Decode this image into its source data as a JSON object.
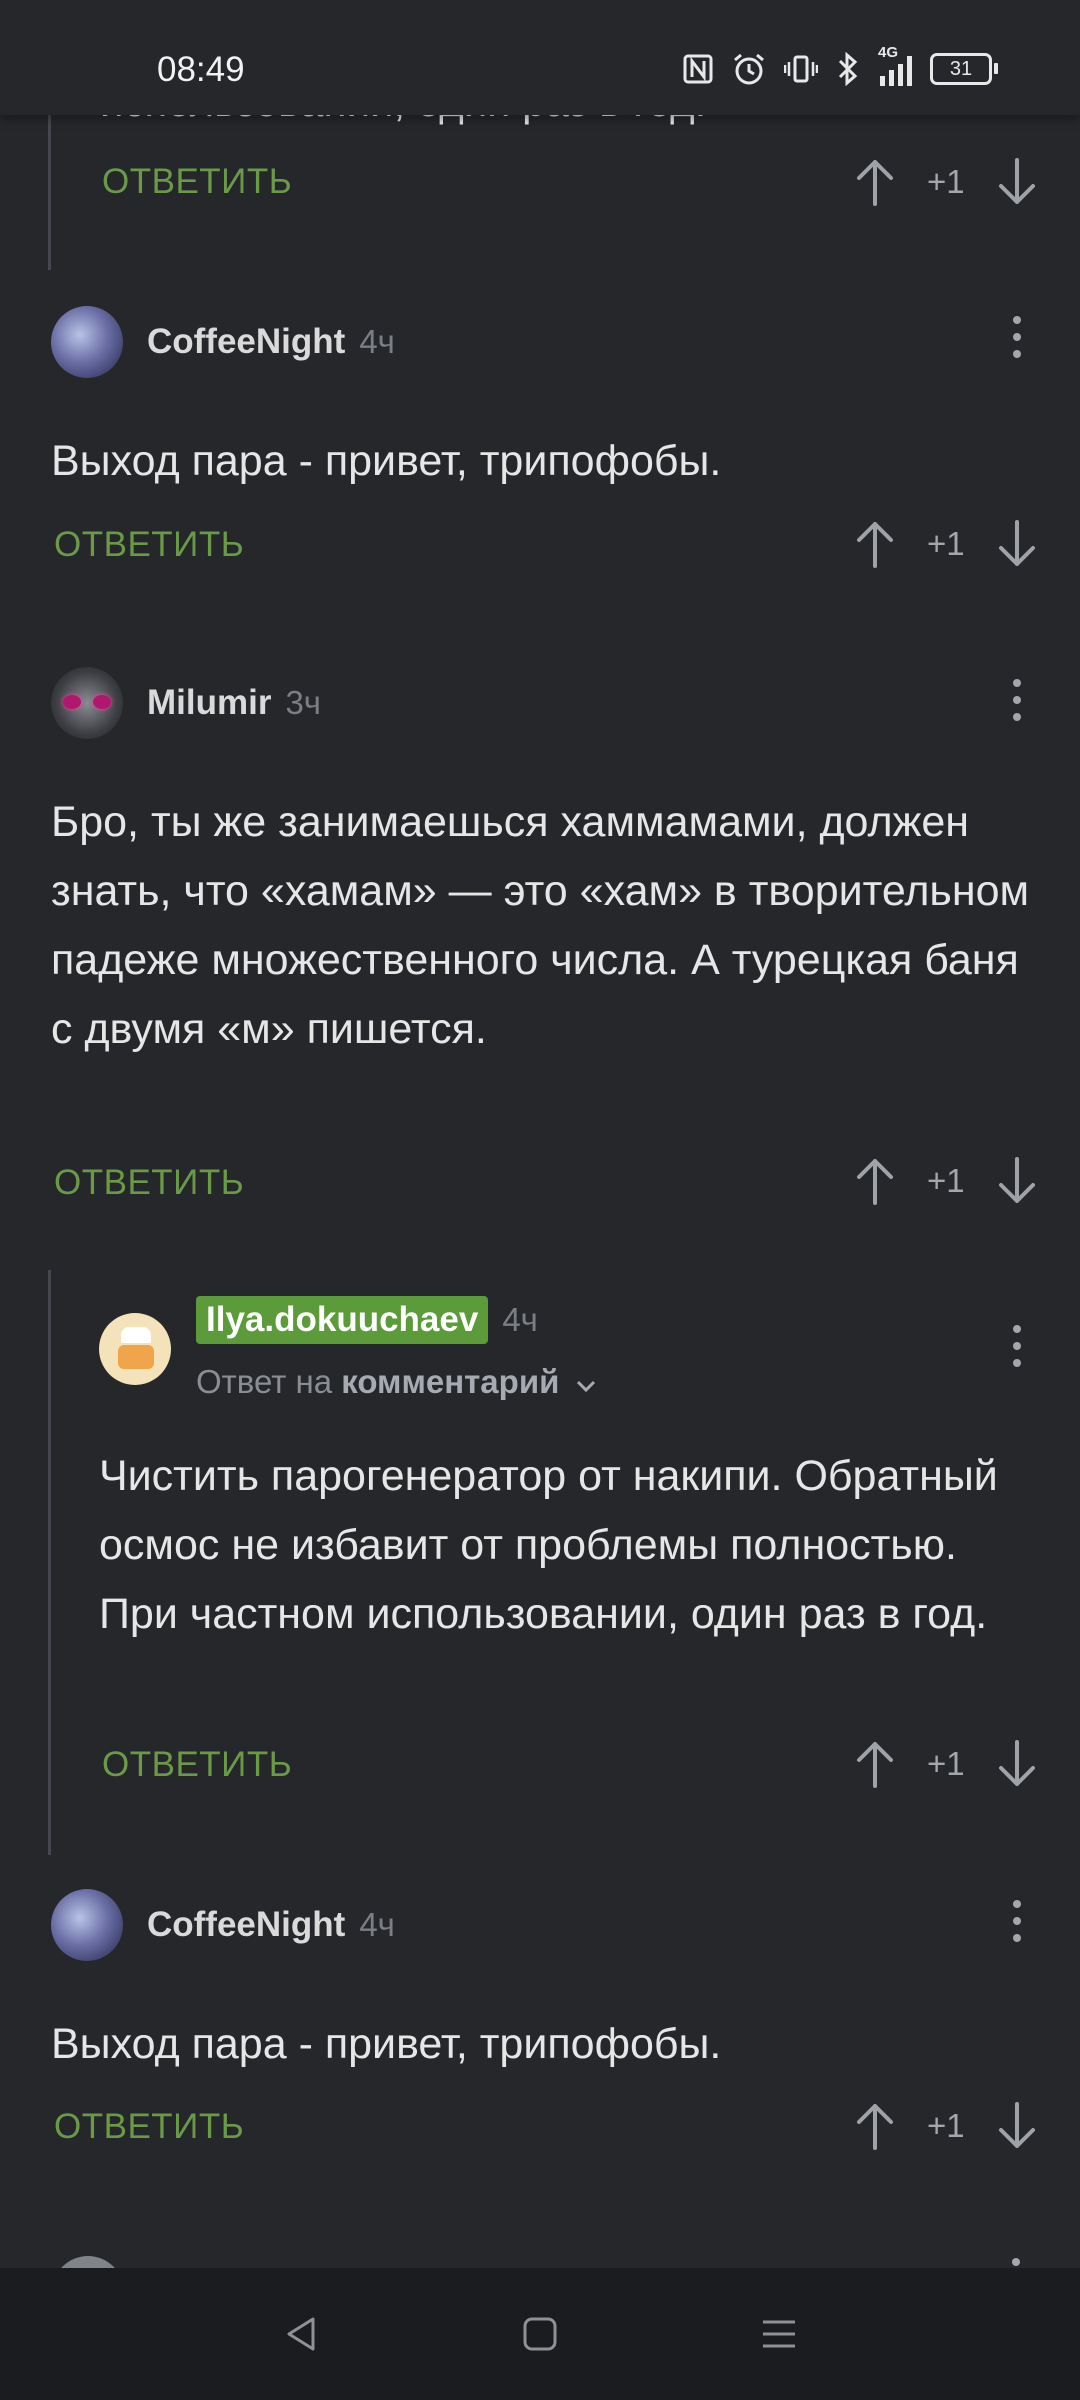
{
  "status": {
    "time": "08:49",
    "icons": [
      "nfc-icon",
      "alarm-icon",
      "vibrate-icon",
      "bluetooth-icon",
      "4g-signal-icon",
      "battery-icon"
    ],
    "network": "4G",
    "battery": "31"
  },
  "cut_text": "использовании, один раз в год.",
  "reply_label": "ОТВЕТИТЬ",
  "vote_label": "+1",
  "comments": [
    {
      "id": "c0"
    },
    {
      "user": "CoffeeNight",
      "ago": "4ч",
      "text": "Выход пара - привет, трипофобы."
    },
    {
      "user": "Milumir",
      "ago": "3ч",
      "text": "Бро, ты же занимаешься хаммамами, должен знать, что «хамам» — это «хам» в творительном падеже множественного числа. А турецкая баня с двумя «м» пишется."
    },
    {
      "user": "Ilya.dokuuchaev",
      "ago": "4ч",
      "reply_to_prefix": "Ответ на",
      "reply_to_target": "комментарий",
      "text": "Чистить парогенератор от накипи. Обратный осмос не избавит от проблемы полностью. При частном использовании, один раз в год."
    },
    {
      "user": "CoffeeNight",
      "ago": "4ч",
      "text": "Выход пара - привет, трипофобы."
    }
  ],
  "colors": {
    "accent_green": "#6a9a47",
    "badge_green": "#5b9b3a",
    "background": "#25272b"
  }
}
